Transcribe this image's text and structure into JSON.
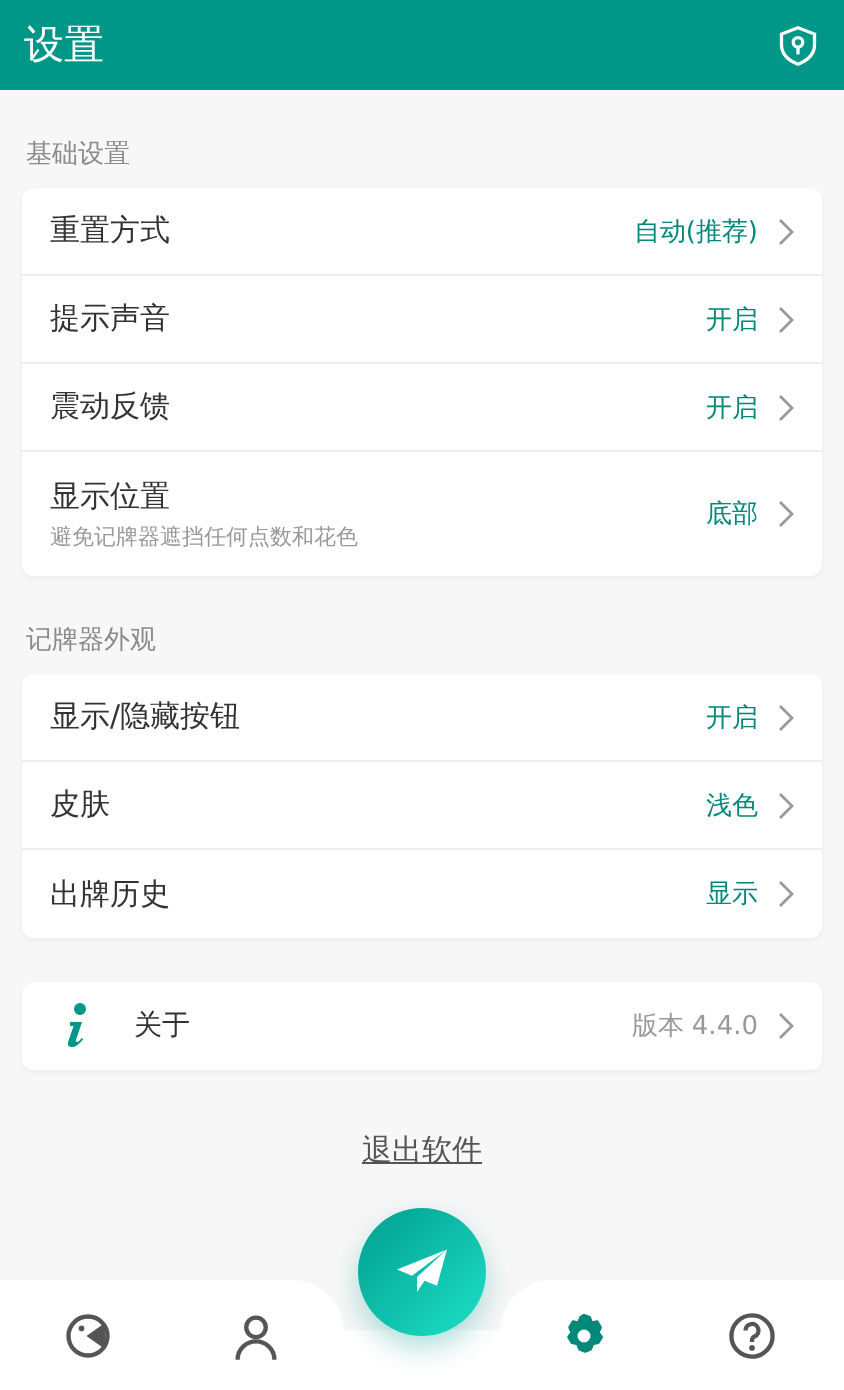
{
  "header": {
    "title": "设置"
  },
  "sections": [
    {
      "title": "基础设置",
      "items": [
        {
          "label": "重置方式",
          "value": "自动(推荐)"
        },
        {
          "label": "提示声音",
          "value": "开启"
        },
        {
          "label": "震动反馈",
          "value": "开启"
        },
        {
          "label": "显示位置",
          "hint": "避免记牌器遮挡任何点数和花色",
          "value": "底部"
        }
      ]
    },
    {
      "title": "记牌器外观",
      "items": [
        {
          "label": "显示/隐藏按钮",
          "value": "开启"
        },
        {
          "label": "皮肤",
          "value": "浅色"
        },
        {
          "label": "出牌历史",
          "value": "显示"
        }
      ]
    }
  ],
  "about": {
    "label": "关于",
    "value": "版本 4.4.0"
  },
  "exit_link": "退出软件",
  "nav": [
    {
      "kind": "game",
      "selected": false
    },
    {
      "kind": "profile",
      "selected": false
    },
    {
      "kind": "settings",
      "selected": true
    },
    {
      "kind": "help",
      "selected": false
    }
  ]
}
